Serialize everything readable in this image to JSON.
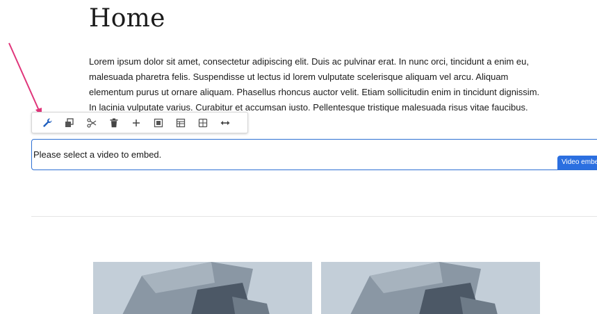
{
  "page": {
    "title": "Home",
    "paragraph": "Lorem ipsum dolor sit amet, consectetur adipiscing elit. Duis ac pulvinar erat. In nunc orci, tincidunt a enim eu, malesuada pharetra felis. Suspendisse ut lectus id lorem vulputate scelerisque aliquam vel arcu. Aliquam elementum purus ut ornare aliquam. Phasellus rhoncus auctor velit. Etiam sollicitudin enim in tincidunt dignissim. In lacinia vulputate varius. Curabitur et accumsan iusto. Pellentesque tristique malesuada risus vitae faucibus. Integer commodo"
  },
  "toolbar": {
    "tools": [
      {
        "name": "configure-wrench-icon",
        "active": true
      },
      {
        "name": "copy-icon"
      },
      {
        "name": "cut-scissors-icon"
      },
      {
        "name": "delete-trash-icon"
      },
      {
        "name": "insert-plus-icon"
      },
      {
        "name": "paste-icon"
      },
      {
        "name": "layout-grid-icon"
      },
      {
        "name": "group-icon"
      },
      {
        "name": "resize-arrows-icon"
      }
    ]
  },
  "video_embed": {
    "placeholder_text": "Please select a video to embed.",
    "badge_label": "Video embed"
  },
  "colors": {
    "accent": "#2b6fe0",
    "selection_border": "#2d6fd3",
    "annotation_arrow": "#e0357a",
    "active_tool": "#1f5fbf"
  }
}
